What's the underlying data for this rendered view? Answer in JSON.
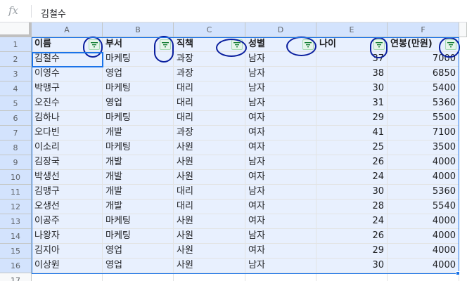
{
  "formula_bar": {
    "fx_label": "fx",
    "value": "김철수"
  },
  "columns": [
    "A",
    "B",
    "C",
    "D",
    "E",
    "F"
  ],
  "rows_numbers": [
    "1",
    "2",
    "3",
    "4",
    "5",
    "6",
    "7",
    "8",
    "9",
    "10",
    "11",
    "12",
    "13",
    "14",
    "15",
    "16",
    "17"
  ],
  "headers": [
    "이름",
    "부서",
    "직책",
    "성별",
    "나이",
    "연봉(만원)"
  ],
  "data": [
    [
      "김철수",
      "마케팅",
      "과장",
      "남자",
      "37",
      "7000"
    ],
    [
      "이영수",
      "영업",
      "과장",
      "남자",
      "38",
      "6850"
    ],
    [
      "박맹구",
      "마케팅",
      "대리",
      "남자",
      "30",
      "5400"
    ],
    [
      "오진수",
      "영업",
      "대리",
      "남자",
      "31",
      "5360"
    ],
    [
      "김하나",
      "마케팅",
      "대리",
      "여자",
      "29",
      "5500"
    ],
    [
      "오다빈",
      "개발",
      "과장",
      "여자",
      "41",
      "7100"
    ],
    [
      "이소리",
      "마케팅",
      "사원",
      "여자",
      "25",
      "3500"
    ],
    [
      "김장국",
      "개발",
      "사원",
      "남자",
      "26",
      "4000"
    ],
    [
      "박생선",
      "개발",
      "사원",
      "여자",
      "24",
      "4000"
    ],
    [
      "김맹구",
      "개발",
      "대리",
      "남자",
      "30",
      "5360"
    ],
    [
      "오생선",
      "개발",
      "대리",
      "여자",
      "28",
      "5540"
    ],
    [
      "이공주",
      "마케팅",
      "사원",
      "여자",
      "24",
      "4000"
    ],
    [
      "나왕자",
      "마케팅",
      "사원",
      "남자",
      "26",
      "4000"
    ],
    [
      "김지아",
      "영업",
      "사원",
      "여자",
      "29",
      "4000"
    ],
    [
      "이상원",
      "영업",
      "사원",
      "남자",
      "30",
      "4000"
    ]
  ],
  "icons": {
    "filter": "filter-icon"
  },
  "colors": {
    "selection_fill": "#e8f0fe",
    "selection_border": "#1a73e8",
    "filter_icon": "#188038",
    "annotation_ink": "#0a1f9e"
  }
}
